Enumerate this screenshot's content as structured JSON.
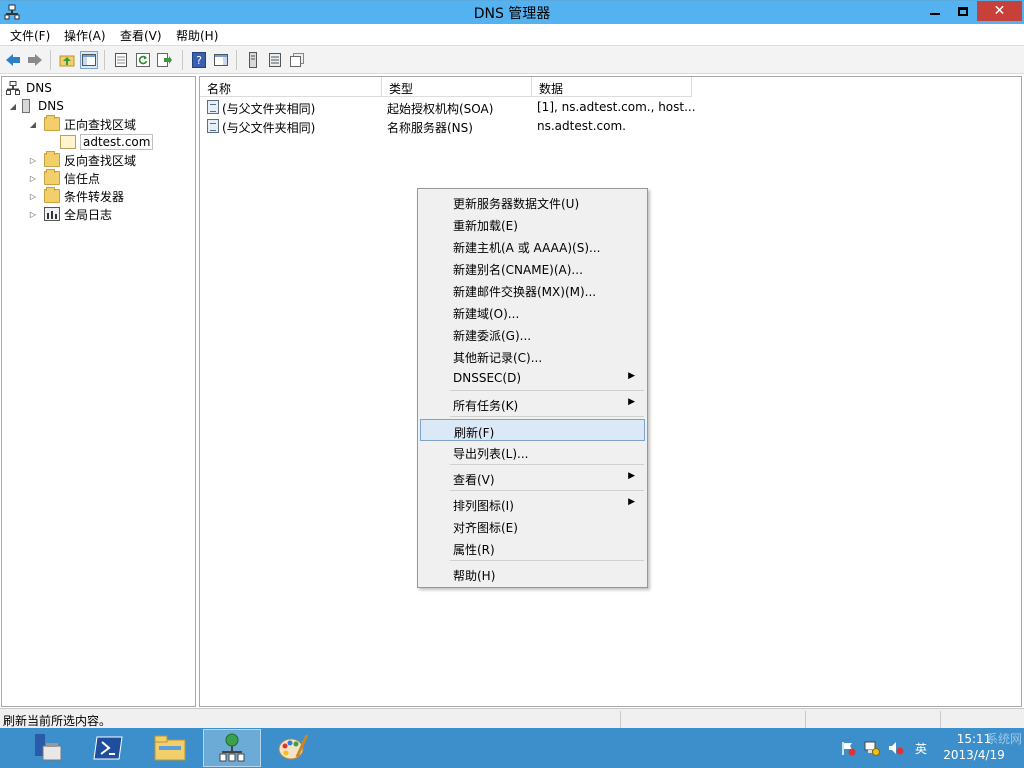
{
  "window": {
    "title": "DNS 管理器"
  },
  "menubar": [
    "文件(F)",
    "操作(A)",
    "查看(V)",
    "帮助(H)"
  ],
  "tree": {
    "root": "DNS",
    "server": "DNS",
    "forward_zones": "正向查找区域",
    "selected_zone": "adtest.com",
    "reverse_zones": "反向查找区域",
    "trust_points": "信任点",
    "conditional_forwarders": "条件转发器",
    "global_logs": "全局日志"
  },
  "list": {
    "columns": [
      "名称",
      "类型",
      "数据"
    ],
    "rows": [
      {
        "name": "(与父文件夹相同)",
        "type": "起始授权机构(SOA)",
        "data": "[1], ns.adtest.com., host..."
      },
      {
        "name": "(与父文件夹相同)",
        "type": "名称服务器(NS)",
        "data": "ns.adtest.com."
      }
    ]
  },
  "context_menu": {
    "items": [
      "更新服务器数据文件(U)",
      "重新加载(E)",
      "新建主机(A 或 AAAA)(S)...",
      "新建别名(CNAME)(A)...",
      "新建邮件交换器(MX)(M)...",
      "新建域(O)...",
      "新建委派(G)...",
      "其他新记录(C)...",
      "DNSSEC(D)",
      "所有任务(K)",
      "刷新(F)",
      "导出列表(L)...",
      "查看(V)",
      "排列图标(I)",
      "对齐图标(E)",
      "属性(R)",
      "帮助(H)"
    ],
    "highlighted": "刷新(F)"
  },
  "statusbar": {
    "text": "刷新当前所选内容。"
  },
  "taskbar": {
    "clock_time": "15:11",
    "clock_date": "2013/4/19",
    "lang": "英",
    "watermark": "系统网"
  },
  "colors": {
    "titlebar": "#53b2ef",
    "close_button": "#c7413a",
    "taskbar": "#3c8fca",
    "menu_highlight": "#dbe8f5"
  }
}
